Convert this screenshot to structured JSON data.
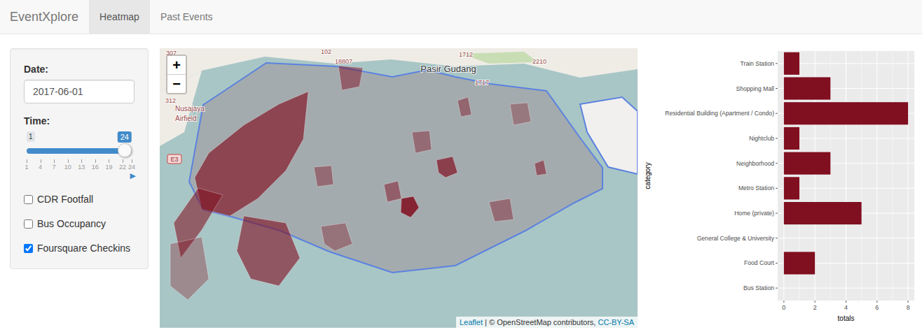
{
  "app": {
    "brand": "EventXplore"
  },
  "tabs": [
    {
      "label": "Heatmap",
      "selected": true
    },
    {
      "label": "Past Events",
      "selected": false
    }
  ],
  "sidebar": {
    "date": {
      "label": "Date:",
      "value": "2017-06-01"
    },
    "time": {
      "label": "Time:",
      "min": "1",
      "value": "24",
      "level": 1,
      "ticks": [
        "1",
        "4",
        "7",
        "10",
        "13",
        "16",
        "19",
        "22",
        "24"
      ],
      "play": "▶"
    },
    "layers": [
      {
        "label": "CDR Footfall",
        "checked": false
      },
      {
        "label": "Bus Occupancy",
        "checked": false
      },
      {
        "label": "Foursquare Checkins",
        "checked": true
      }
    ]
  },
  "map": {
    "zoom_in": "+",
    "zoom_out": "−",
    "labels": [
      "307",
      "102",
      "18807",
      "1712",
      "2210",
      "Pasir Gudang",
      "1717",
      "312",
      "Nusajaya",
      "Airfield",
      "E3"
    ],
    "base_level": 0.08,
    "regions": [
      {
        "level": 0.7
      },
      {
        "level": 0.6
      },
      {
        "level": 0.95
      },
      {
        "level": 0.75
      },
      {
        "level": 0.65
      },
      {
        "level": 0.3
      },
      {
        "level": 0.5
      },
      {
        "level": 0.45
      },
      {
        "level": 0.55
      },
      {
        "level": 0.35
      },
      {
        "level": 0.5
      },
      {
        "level": 0.4
      },
      {
        "level": 0.4
      },
      {
        "level": 0.3
      },
      {
        "level": 0.4
      }
    ],
    "attribution": {
      "leaflet": "Leaflet",
      "separator": "|",
      "text": "© OpenStreetMap contributors,",
      "license": "CC-BY-SA"
    }
  },
  "chart": {
    "categories": [
      "Train Station",
      "Shopping Mall",
      "Residential Building (Apartment / Condo)",
      "Nightclub",
      "Neighborhood",
      "Metro Station",
      "Home (private)",
      "General College & University",
      "Food Court",
      "Bus Station"
    ],
    "values": [
      1,
      3,
      8,
      1,
      3,
      1,
      5,
      0,
      2,
      0
    ],
    "x_ticks": [
      "0",
      "2",
      "4",
      "6",
      "8"
    ],
    "x_title": "totals",
    "y_title": "category"
  }
}
